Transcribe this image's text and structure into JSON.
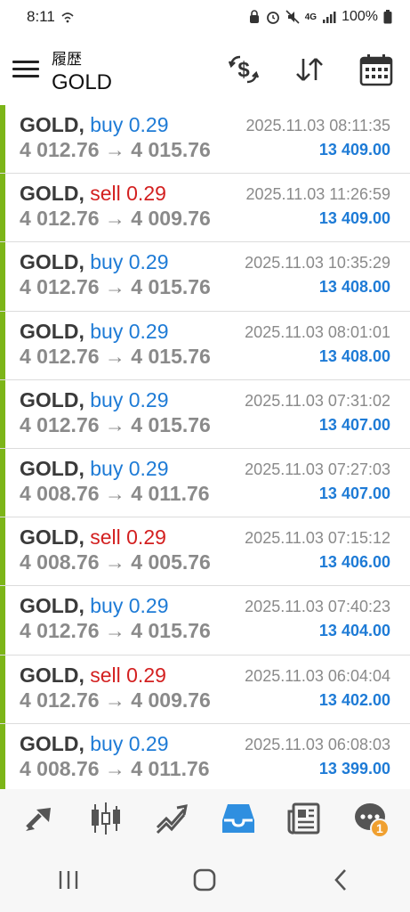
{
  "status_bar": {
    "time": "8:11",
    "network": "4G",
    "battery": "100%"
  },
  "header": {
    "subtitle": "履歴",
    "title": "GOLD",
    "icons": [
      "menu-icon",
      "currency-exchange-icon",
      "sort-icon",
      "calendar-icon"
    ]
  },
  "colors": {
    "buy": "#1e7bd6",
    "sell": "#d32020",
    "accent_bar": "#7cb518",
    "balance": "#1e7bd6",
    "muted": "#8a8a8a"
  },
  "trades": [
    {
      "symbol": "GOLD,",
      "side": "buy",
      "volume": "0.29",
      "prices": "4 012.76 → 4 015.76",
      "time": "2025.11.03 08:11:35",
      "balance": "13 409.00"
    },
    {
      "symbol": "GOLD,",
      "side": "sell",
      "volume": "0.29",
      "prices": "4 012.76 → 4 009.76",
      "time": "2025.11.03 11:26:59",
      "balance": "13 409.00"
    },
    {
      "symbol": "GOLD,",
      "side": "buy",
      "volume": "0.29",
      "prices": "4 012.76 → 4 015.76",
      "time": "2025.11.03 10:35:29",
      "balance": "13 408.00"
    },
    {
      "symbol": "GOLD,",
      "side": "buy",
      "volume": "0.29",
      "prices": "4 012.76 → 4 015.76",
      "time": "2025.11.03 08:01:01",
      "balance": "13 408.00"
    },
    {
      "symbol": "GOLD,",
      "side": "buy",
      "volume": "0.29",
      "prices": "4 012.76 → 4 015.76",
      "time": "2025.11.03 07:31:02",
      "balance": "13 407.00"
    },
    {
      "symbol": "GOLD,",
      "side": "buy",
      "volume": "0.29",
      "prices": "4 008.76 → 4 011.76",
      "time": "2025.11.03 07:27:03",
      "balance": "13 407.00"
    },
    {
      "symbol": "GOLD,",
      "side": "sell",
      "volume": "0.29",
      "prices": "4 008.76 → 4 005.76",
      "time": "2025.11.03 07:15:12",
      "balance": "13 406.00"
    },
    {
      "symbol": "GOLD,",
      "side": "buy",
      "volume": "0.29",
      "prices": "4 012.76 → 4 015.76",
      "time": "2025.11.03 07:40:23",
      "balance": "13 404.00"
    },
    {
      "symbol": "GOLD,",
      "side": "sell",
      "volume": "0.29",
      "prices": "4 012.76 → 4 009.76",
      "time": "2025.11.03 06:04:04",
      "balance": "13 402.00"
    },
    {
      "symbol": "GOLD,",
      "side": "buy",
      "volume": "0.29",
      "prices": "4 008.76 → 4 011.76",
      "time": "2025.11.03 06:08:03",
      "balance": "13 399.00"
    }
  ],
  "bottom_nav": {
    "items": [
      "trade-icon",
      "chart-candles-icon",
      "trend-icon",
      "inbox-icon",
      "news-icon",
      "chat-icon"
    ],
    "chat_badge": "1",
    "active": "inbox-icon",
    "active_color": "#2f8fe0"
  },
  "system_nav": [
    "recents-icon",
    "home-icon",
    "back-icon"
  ]
}
